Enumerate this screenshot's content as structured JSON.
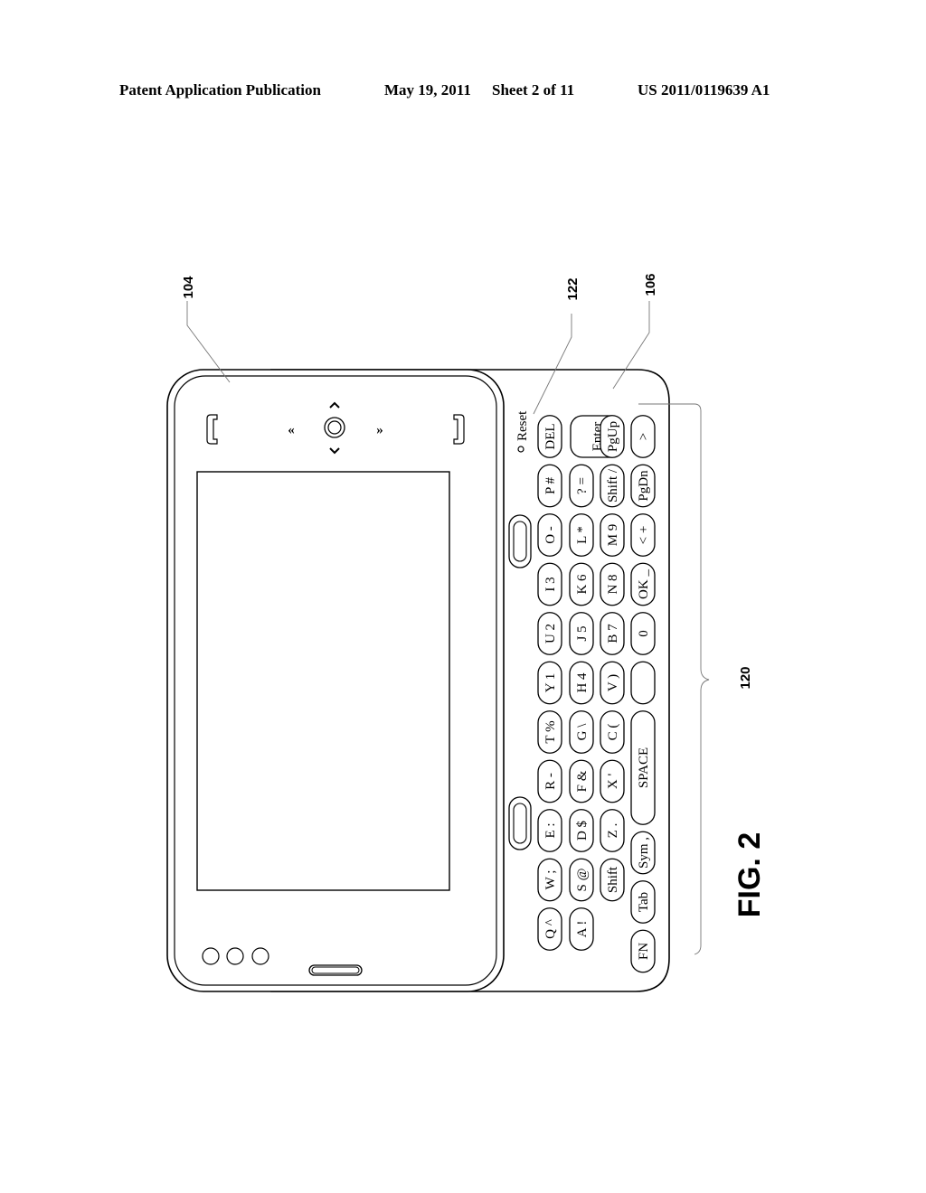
{
  "header": {
    "publication": "Patent Application Publication",
    "date": "May 19, 2011",
    "sheet": "Sheet 2 of 11",
    "number": "US 2011/0119639 A1"
  },
  "figure": {
    "label": "FIG. 2",
    "refs": {
      "display_housing": "104",
      "reset": "122",
      "keyboard_housing": "106",
      "keyboard": "120"
    },
    "reset_label": "Reset",
    "nav": {
      "left": "«",
      "right": "»",
      "up": "^",
      "down": "ˇ"
    },
    "keyboard_columns": [
      [
        "DEL",
        "P #",
        "O -",
        "I 3",
        "U 2",
        "Y 1",
        "T %",
        "R -",
        "E :",
        "W ;",
        "Q ^"
      ],
      [
        "Enter",
        "? =",
        "L *",
        "K 6",
        "J 5",
        "H 4",
        "G \\",
        "F &",
        "D $",
        "S @",
        "A !"
      ],
      [
        "PgUp",
        "Shift /",
        "M 9",
        "N 8",
        "B 7",
        "V )",
        "C (",
        "X '",
        "Z .",
        "Shift"
      ],
      [
        ">",
        "PgDn",
        "< +",
        "OK _",
        "0",
        "",
        "SPACE",
        "Sym ,",
        "Tab",
        "FN"
      ]
    ]
  }
}
